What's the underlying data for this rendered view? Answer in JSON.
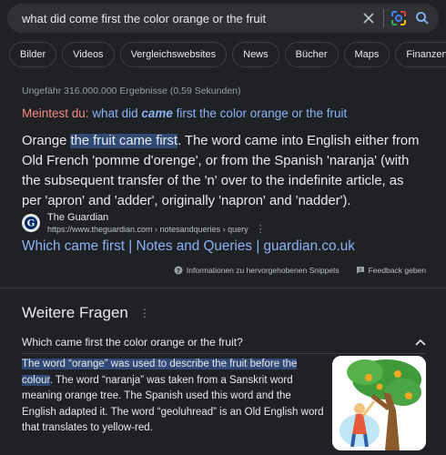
{
  "search": {
    "query": "what did come first the color orange or the fruit"
  },
  "chips": [
    "Bilder",
    "Videos",
    "Vergleichswebsites",
    "News",
    "Bücher",
    "Maps",
    "Finanzen"
  ],
  "stats": "Ungefähr 316.000.000 Ergebnisse (0,59 Sekunden)",
  "did_you_mean": {
    "label": "Meintest du:",
    "query_before": "what did",
    "query_bold": "came",
    "query_after": "first the color orange or the fruit"
  },
  "featured_snippet": {
    "lead": "Orange",
    "highlight": "the fruit came first",
    "rest": ". The word came into English either from Old French 'pomme d'orenge', or from the Spanish 'naranja' (with the subsequent transfer of the 'n' over to the indefinite article, as per 'apron' and 'adder', originally 'napron' and 'nadder')."
  },
  "source": {
    "name": "The Guardian",
    "url": "https://www.theguardian.com › notesandqueries › query",
    "link_title": "Which came first | Notes and Queries | guardian.co.uk"
  },
  "feedback": {
    "info_label": "Informationen zu hervorgehobenen Snippets",
    "feedback_label": "Feedback geben"
  },
  "people_also_ask": {
    "title": "Weitere Fragen",
    "question": "Which came first the color orange or the fruit?",
    "answer_highlight": "The word “orange” was used to describe the fruit before the colour",
    "answer_rest": ". The word “naranja” was taken from a Sanskrit word meaning orange tree. The Spanish used this word and the English adapted it. The word “geoluhread” is an Old English word that translates to yellow-red."
  },
  "colors": {
    "background": "#202124",
    "link": "#8ab4f8",
    "highlight": "#304a75",
    "did_you_mean_label": "#f28b82"
  },
  "icons": [
    "clear-icon",
    "google-lens-icon",
    "search-icon",
    "guardian-favicon",
    "more-options-icon",
    "info-icon",
    "feedback-icon",
    "expand-less-icon"
  ]
}
